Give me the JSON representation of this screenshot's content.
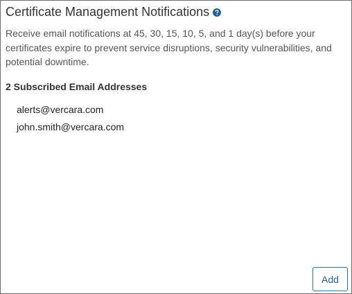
{
  "panel": {
    "title": "Certificate Management Notifications",
    "help_icon": "question-circle-icon",
    "description": "Receive email notifications at 45, 30, 15, 10, 5, and 1 day(s) before your certificates expire to prevent service disruptions, security vulnerabilities, and potential downtime.",
    "subscribed_heading": "2 Subscribed Email Addresses",
    "emails": [
      "alerts@vercara.com",
      "john.smith@vercara.com"
    ],
    "add_label": "Add"
  },
  "colors": {
    "title_text": "#333333",
    "help_icon": "#1f5f98",
    "button_border": "#2f6fa8",
    "button_text": "#1f5f98",
    "panel_border": "#6b6b6b"
  }
}
